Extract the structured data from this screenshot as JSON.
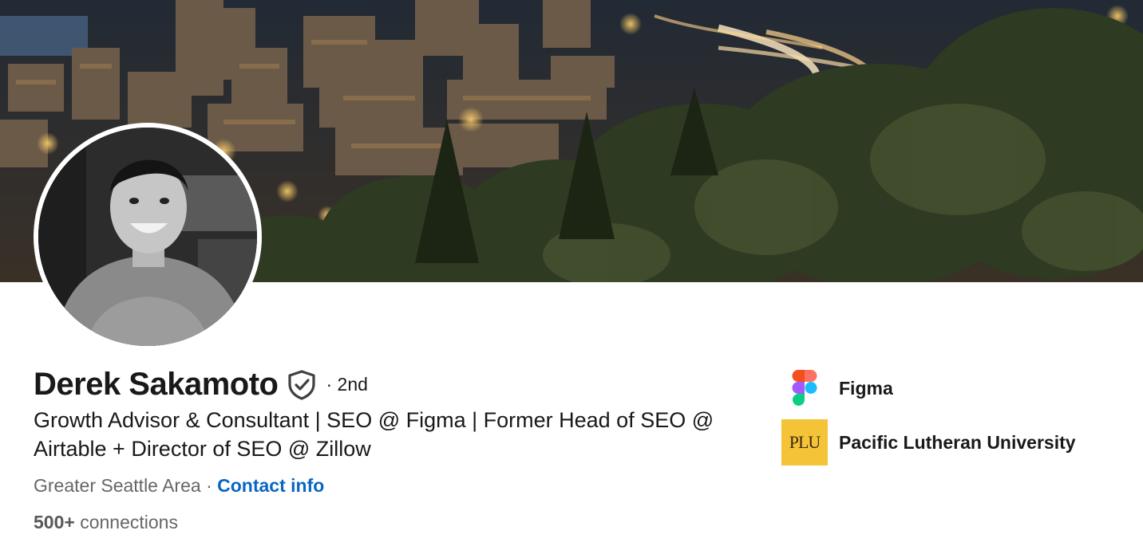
{
  "banner": {
    "description_icon": "city-night-photo"
  },
  "profile": {
    "name": "Derek Sakamoto",
    "verified_icon": "shield-check-icon",
    "degree": "· 2nd",
    "headline": "Growth Advisor & Consultant | SEO @ Figma | Former Head of SEO @ Airtable + Director of SEO @ Zillow",
    "location": "Greater Seattle Area",
    "separator": " · ",
    "contact_label": "Contact info",
    "connections_count": "500+",
    "connections_label": " connections"
  },
  "orgs": [
    {
      "name": "Figma",
      "icon": "figma-logo"
    },
    {
      "name": "Pacific Lutheran University",
      "icon": "plu-logo",
      "logo_text": "PLU"
    }
  ],
  "colors": {
    "link": "#0a66c2",
    "plu_gold": "#f5c338"
  }
}
